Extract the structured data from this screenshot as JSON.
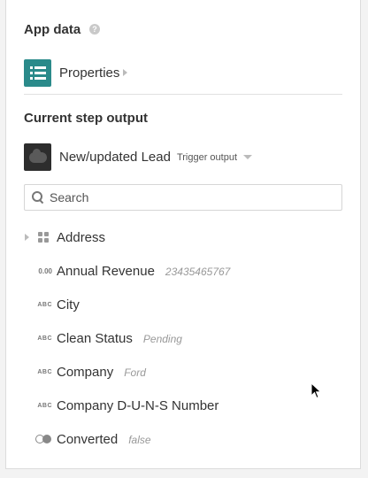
{
  "app_data": {
    "title": "App data",
    "help_icon": "question-circle-icon",
    "properties_label": "Properties"
  },
  "current_step": {
    "title": "Current step output",
    "step_label": "New/updated Lead",
    "trigger_label": "Trigger output",
    "icon": "salesforce-icon"
  },
  "search": {
    "placeholder": "Search",
    "value": ""
  },
  "fields": [
    {
      "type_tag": "",
      "type_icon": "object-grid-icon",
      "name": "Address",
      "value": "",
      "expandable": true
    },
    {
      "type_tag": "0.00",
      "type_icon": "number-icon",
      "name": "Annual Revenue",
      "value": "23435465767",
      "expandable": false
    },
    {
      "type_tag": "ABC",
      "type_icon": "string-icon",
      "name": "City",
      "value": "",
      "expandable": false
    },
    {
      "type_tag": "ABC",
      "type_icon": "string-icon",
      "name": "Clean Status",
      "value": "Pending",
      "expandable": false
    },
    {
      "type_tag": "ABC",
      "type_icon": "string-icon",
      "name": "Company",
      "value": "Ford",
      "expandable": false
    },
    {
      "type_tag": "ABC",
      "type_icon": "string-icon",
      "name": "Company D-U-N-S Number",
      "value": "",
      "expandable": false
    },
    {
      "type_tag": "",
      "type_icon": "boolean-icon",
      "name": "Converted",
      "value": "false",
      "expandable": false
    }
  ],
  "colors": {
    "properties_icon_bg": "#2a8a8a",
    "salesforce_icon_bg": "#2d2d2d",
    "value_text": "#999999"
  }
}
